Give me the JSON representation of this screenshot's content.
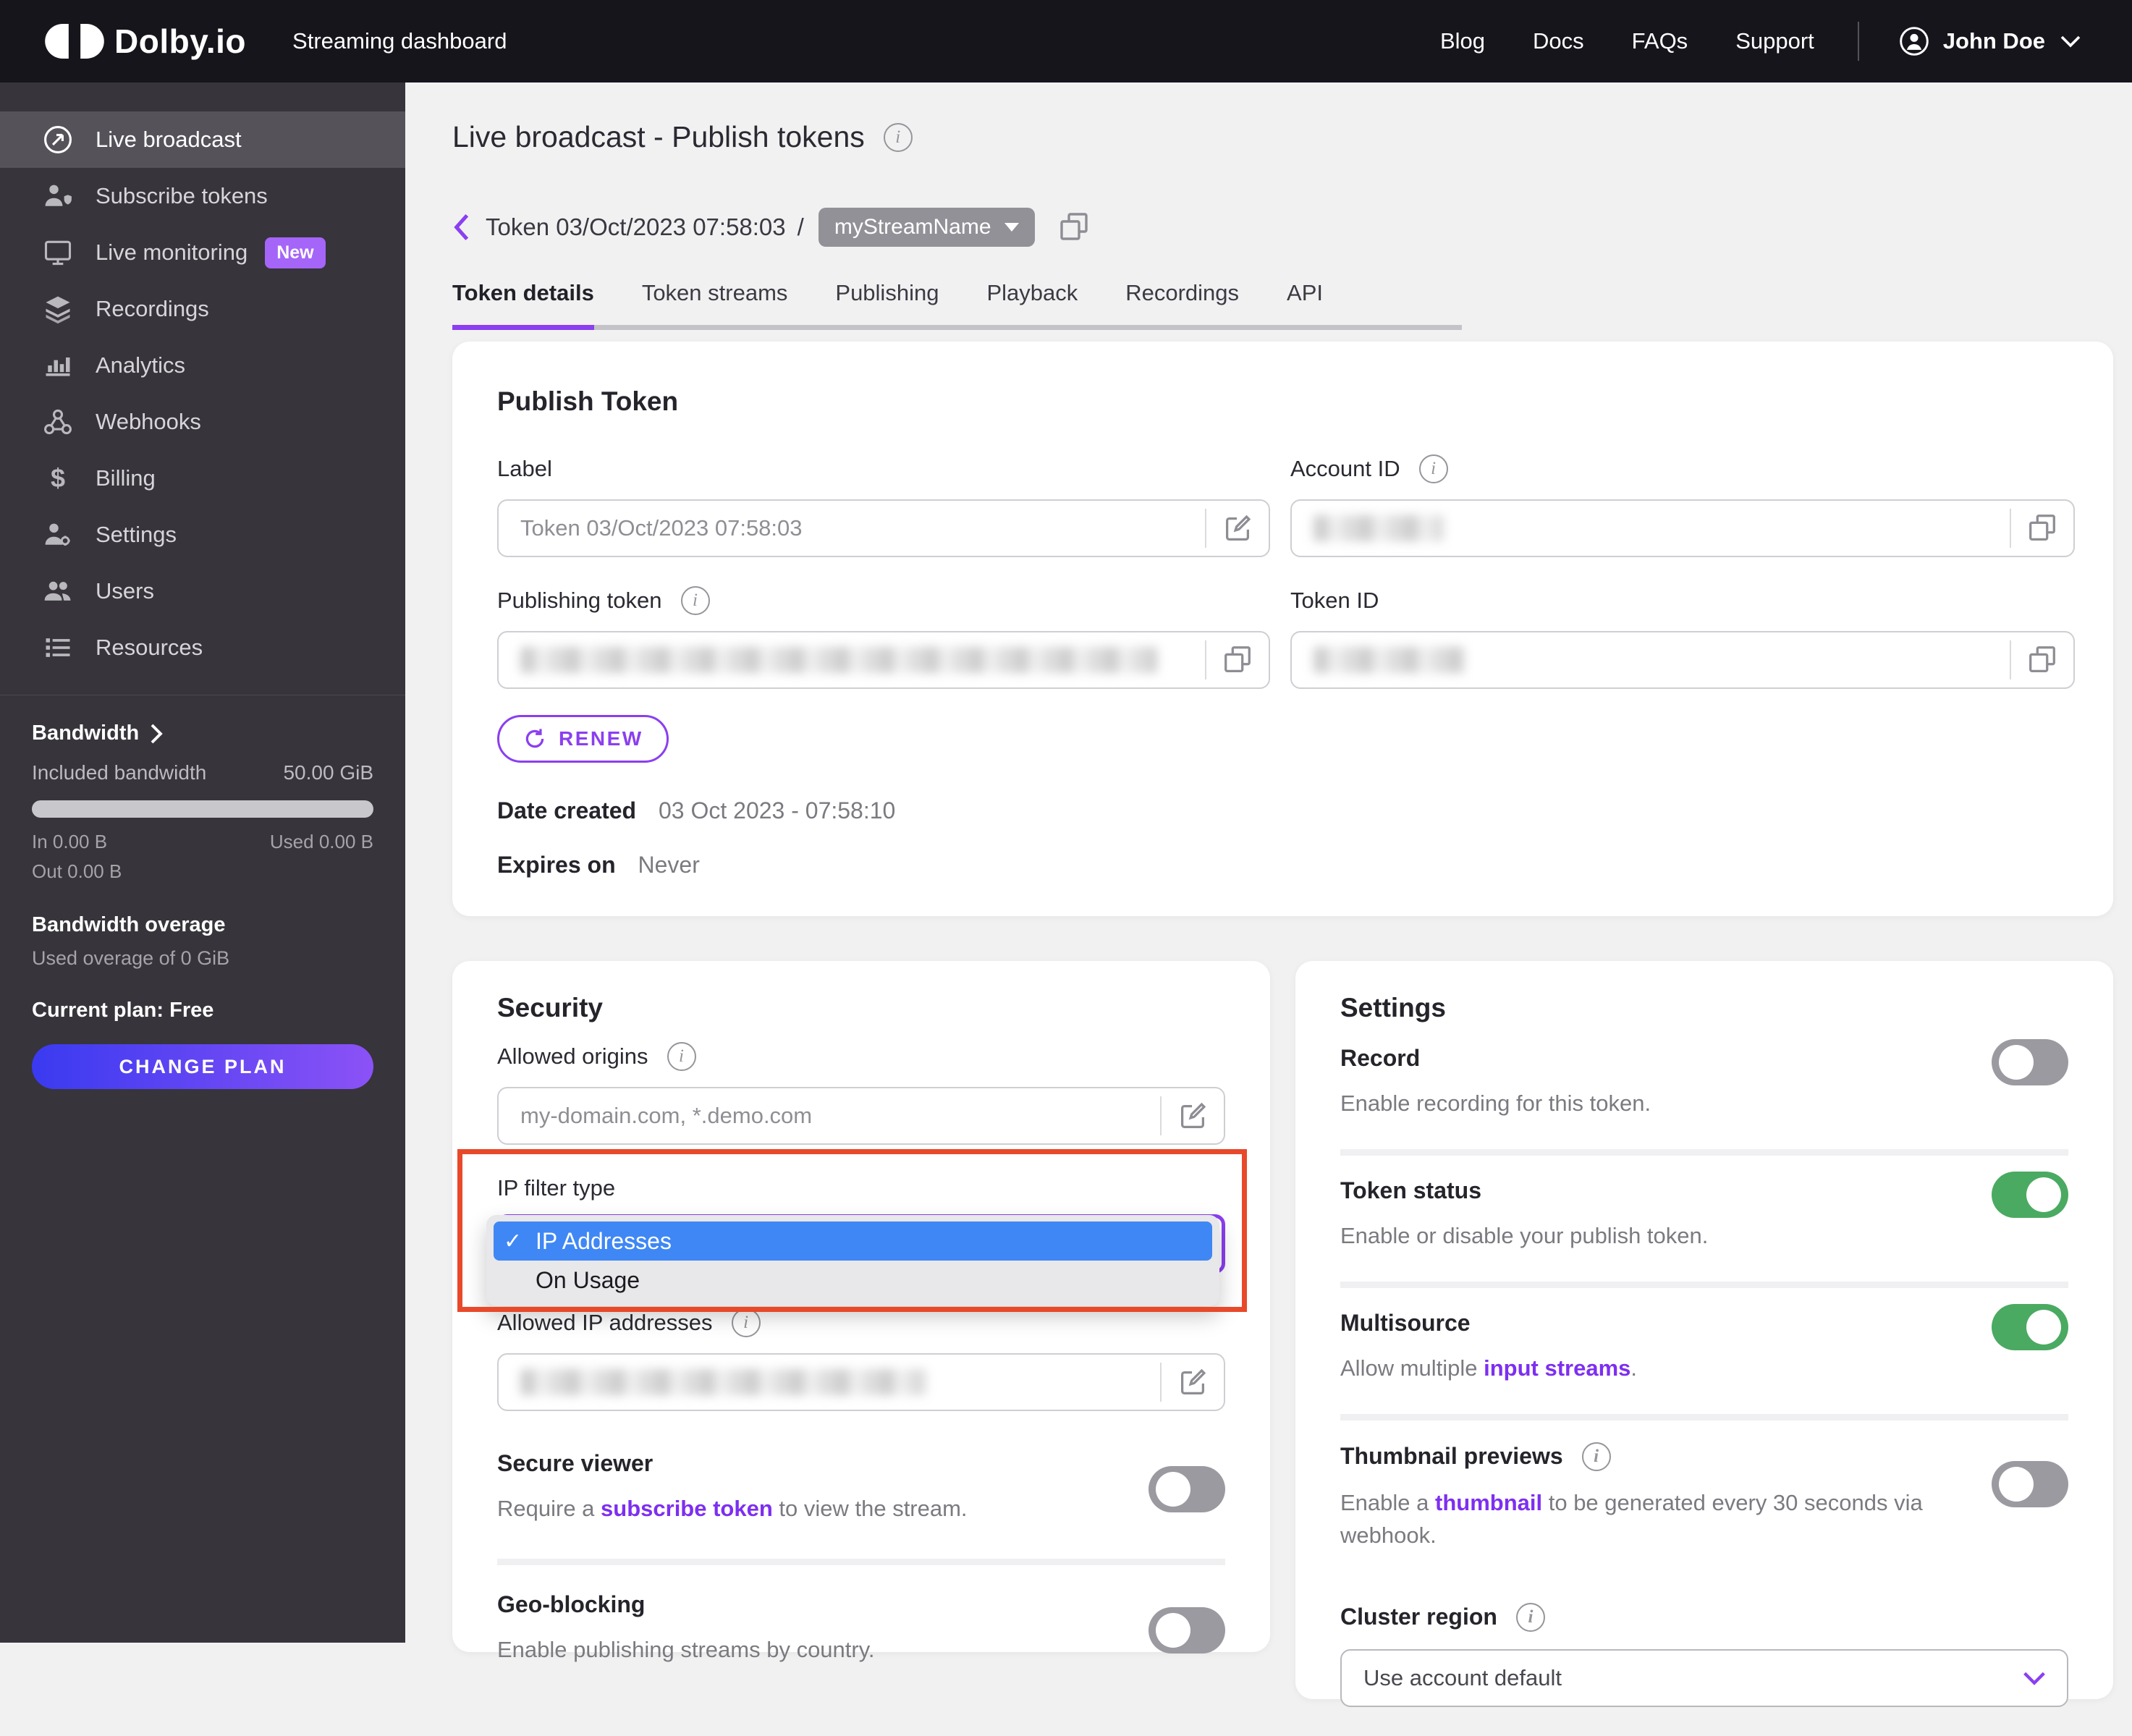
{
  "header": {
    "logo_text": "Dolby.io",
    "product": "Streaming dashboard",
    "nav": [
      {
        "label": "Blog"
      },
      {
        "label": "Docs"
      },
      {
        "label": "FAQs"
      },
      {
        "label": "Support"
      }
    ],
    "user_name": "John Doe"
  },
  "sidebar": {
    "items": [
      {
        "label": "Live broadcast"
      },
      {
        "label": "Subscribe tokens"
      },
      {
        "label": "Live monitoring",
        "badge": "New"
      },
      {
        "label": "Recordings"
      },
      {
        "label": "Analytics"
      },
      {
        "label": "Webhooks"
      },
      {
        "label": "Billing"
      },
      {
        "label": "Settings"
      },
      {
        "label": "Users"
      },
      {
        "label": "Resources"
      }
    ],
    "bandwidth": {
      "title": "Bandwidth",
      "included_label": "Included bandwidth",
      "included_value": "50.00 GiB",
      "in_label": "In 0.00 B",
      "used_label": "Used 0.00 B",
      "out_label": "Out 0.00 B",
      "overage_title": "Bandwidth overage",
      "overage_detail": "Used overage of 0 GiB",
      "plan": "Current plan: Free",
      "change_plan_label": "CHANGE PLAN"
    }
  },
  "page": {
    "title": "Live broadcast - Publish tokens",
    "breadcrumb_token": "Token 03/Oct/2023 07:58:03",
    "breadcrumb_sep": "/",
    "stream_name": "myStreamName",
    "tabs": [
      {
        "label": "Token details",
        "active": true
      },
      {
        "label": "Token streams",
        "active": false
      },
      {
        "label": "Publishing",
        "active": false
      },
      {
        "label": "Playback",
        "active": false
      },
      {
        "label": "Recordings",
        "active": false
      },
      {
        "label": "API",
        "active": false
      }
    ]
  },
  "publish_token": {
    "heading": "Publish Token",
    "label_label": "Label",
    "label_value": "Token 03/Oct/2023 07:58:03",
    "account_id_label": "Account ID",
    "account_id_redacted": true,
    "publishing_token_label": "Publishing token",
    "publishing_token_redacted": true,
    "token_id_label": "Token ID",
    "token_id_redacted": true,
    "renew_label": "RENEW",
    "date_created_label": "Date created",
    "date_created_value": "03 Oct 2023 - 07:58:10",
    "expires_label": "Expires on",
    "expires_value": "Never"
  },
  "security": {
    "heading": "Security",
    "allowed_origins_label": "Allowed origins",
    "allowed_origins_placeholder": "my-domain.com, *.demo.com",
    "ip_filter_label": "IP filter type",
    "checkmark": "✓",
    "ip_filter_options": [
      {
        "label": "IP Addresses",
        "selected": true
      },
      {
        "label": "On Usage",
        "selected": false
      }
    ],
    "allowed_ips_label": "Allowed IP addresses",
    "allowed_ips_redacted": true,
    "secure_viewer_label": "Secure viewer",
    "secure_viewer_desc_pre": "Require a ",
    "secure_viewer_desc_link": "subscribe token",
    "secure_viewer_desc_post": " to view the stream.",
    "secure_viewer_enabled": false,
    "geo_label": "Geo-blocking",
    "geo_desc": "Enable publishing streams by country.",
    "geo_enabled": false
  },
  "settings": {
    "heading": "Settings",
    "record_label": "Record",
    "record_desc": "Enable recording for this token.",
    "record_enabled": false,
    "token_status_label": "Token status",
    "token_status_desc": "Enable or disable your publish token.",
    "token_status_enabled": true,
    "multisource_label": "Multisource",
    "multisource_desc_pre": "Allow multiple ",
    "multisource_desc_link": "input streams",
    "multisource_desc_post": ".",
    "multisource_enabled": true,
    "thumbnail_label": "Thumbnail previews",
    "thumbnail_desc_pre": "Enable a ",
    "thumbnail_desc_link": "thumbnail",
    "thumbnail_desc_post": " to be generated every 30 seconds via webhook.",
    "thumbnail_enabled": false,
    "cluster_label": "Cluster region",
    "cluster_value": "Use account default"
  },
  "colors": {
    "accent_purple": "#8b3ff0",
    "toggle_on_green": "#4aaa61",
    "highlight_red": "#e8492a",
    "dropdown_selection_blue": "#3f87f5",
    "header_bg": "#17151c",
    "sidebar_bg": "#37343b"
  }
}
